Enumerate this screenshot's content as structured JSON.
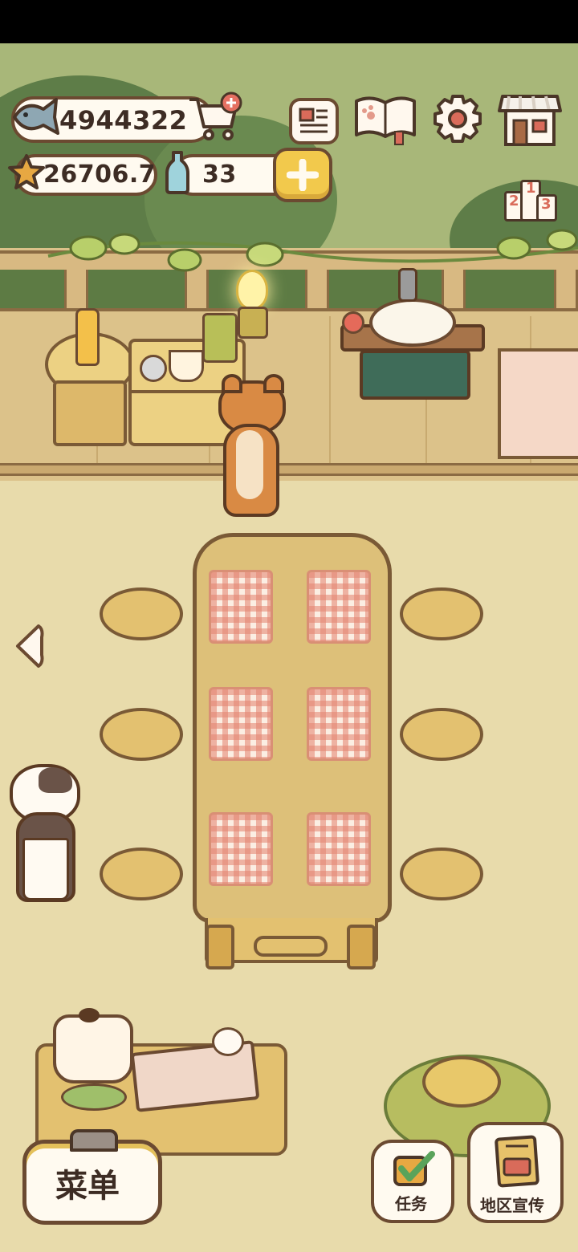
{
  "hud": {
    "fish_currency": "4944322",
    "star_currency": "26706.7",
    "bottle_currency": "33"
  },
  "icons": {
    "fish": "fish-icon",
    "cart": "shop-cart-icon",
    "star": "star-icon",
    "bottle": "bottle-icon",
    "add": "plus-icon",
    "news": "newspaper-icon",
    "book": "recipe-book-icon",
    "settings": "gear-icon",
    "shop": "shop-icon",
    "ranking": "ranking-podium-icon",
    "back": "left-arrow-icon",
    "tasks": "task-checklist-icon",
    "promo": "promotion-poster-icon"
  },
  "ranking": {
    "first": "1",
    "second": "2",
    "third": "3"
  },
  "buttons": {
    "menu_label": "菜单",
    "tasks_label": "任务",
    "promo_label": "地区宣传"
  },
  "colors": {
    "background": "#e8dbab",
    "outline": "#6b4a31",
    "accent_yellow": "#f2c94c"
  }
}
